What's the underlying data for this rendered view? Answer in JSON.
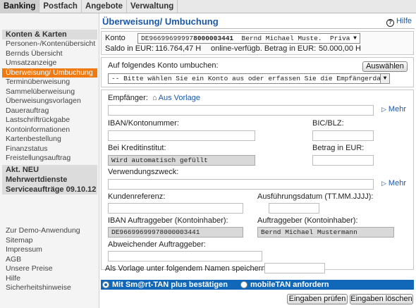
{
  "topbar": {
    "tabs": [
      {
        "label": "Banking"
      },
      {
        "label": "Postfach"
      },
      {
        "label": "Angebote"
      },
      {
        "label": "Verwaltung"
      }
    ]
  },
  "sidebar": {
    "section1_title": "Konten & Karten",
    "items": [
      "Personen-/Kontenübersicht",
      "Bernds Übersicht",
      "Umsatzanzeige",
      "Überweisung/ Umbuchung",
      "Terminüberweisung",
      "Sammelüberweisung",
      "Überweisungsvorlagen",
      "Dauerauftrag",
      "Lastschriftrückgabe",
      "Kontoinformationen",
      "Kartenbestellung",
      "Finanzstatus",
      "Freistellungsauftrag"
    ],
    "section2_title": "Akt. NEU",
    "section3_title": "Mehrwertdienste",
    "section4_title": "Serviceaufträge 09.10.12",
    "bottom_items": [
      "Zur Demo-Anwendung",
      "Sitemap",
      "Impressum",
      "AGB",
      "Unsere Preise",
      "Hilfe",
      "Sicherheitshinweise"
    ]
  },
  "main": {
    "title": "Überweisung/ Umbuchung",
    "help_label": "Hilfe",
    "konto_label": "Konto",
    "konto_value_prefix": "DE96699699997",
    "konto_value_bold": "8000003441",
    "konto_value_suffix": "  Bernd Michael Muste.  Privatko.",
    "saldo_label": "Saldo in EUR:",
    "saldo_value": "116.764,47 H",
    "verfuegbar_label": "online-verfügb. Betrag in EUR:",
    "verfuegbar_value": "50.000,00 H",
    "umbuchen_label": "Auf folgendes Konto umbuchen:",
    "auswaehlen_button": "Auswählen",
    "umbuchen_select": "-- Bitte wählen Sie ein Konto aus oder erfassen Sie die Empfängerdaten--",
    "empfaenger_label": "Empfänger:",
    "aus_vorlage_link": "Aus Vorlage",
    "mehr_link_1": "Mehr",
    "iban_label": "IBAN/Kontonummer:",
    "bic_label": "BIC/BLZ:",
    "kreditinstitut_label": "Bei Kreditinstitut:",
    "kreditinstitut_value": "Wird automatisch gefüllt",
    "betrag_label": "Betrag in EUR:",
    "verwendungszweck_label": "Verwendungszweck:",
    "mehr_link_2": "Mehr",
    "kundenreferenz_label": "Kundenreferenz:",
    "ausfuehrungsdatum_label": "Ausführungsdatum (TT.MM.JJJJ):",
    "iban_auftraggeber_label": "IBAN Auftraggeber (Kontoinhaber):",
    "iban_auftraggeber_value": "DE96699699978000003441",
    "auftraggeber_label": "Auftraggeber (Kontoinhaber):",
    "auftraggeber_value": "Bernd Michael Mustermann",
    "abweichender_label": "Abweichender Auftraggeber:",
    "vorlage_label": "Als Vorlage unter folgendem Namen speichern:",
    "tan_option_1": "Mit Sm@rt-TAN plus bestätigen",
    "tan_option_2": "mobileTAN anfordern",
    "pruefen_button": "Eingaben prüfen",
    "loeschen_button": "Eingaben löschen"
  },
  "colors": {
    "accent_orange": "#f07a10",
    "title_blue": "#1c58a8",
    "tan_bar_blue": "#1268b8"
  }
}
